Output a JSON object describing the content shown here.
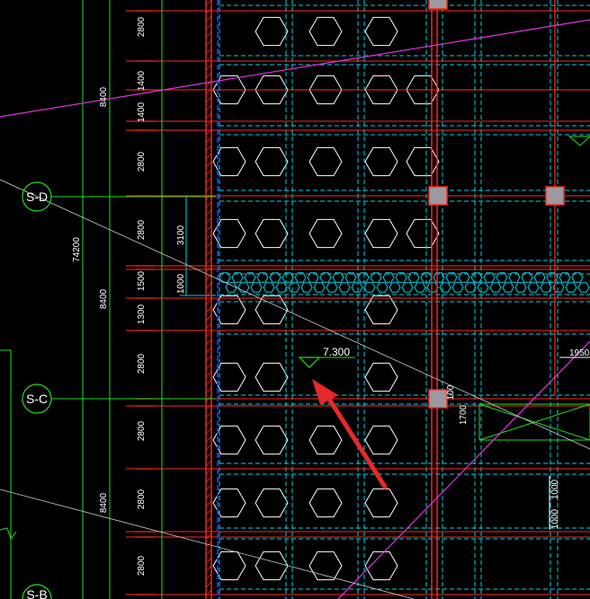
{
  "colors": {
    "background": "#000000",
    "red_lines": "#ff2a1f",
    "dark_red": "#c81414",
    "cyan": "#00d2e6",
    "green": "#22dd22",
    "white": "#ffffff",
    "magenta": "#e632e6",
    "blue_wall": "#2233ff",
    "gray_column": "#9a9aa0",
    "arrow": "#e8282a"
  },
  "grid_axes": [
    {
      "label": "S-D"
    },
    {
      "label": "S-C"
    },
    {
      "label": "S-B"
    }
  ],
  "dimensions": {
    "vertical_segments": [
      "2800",
      "1400",
      "1400",
      "2800",
      "2800",
      "1500",
      "1300",
      "2800",
      "2800",
      "2800",
      "2800",
      "2800"
    ],
    "bay_totals": [
      "8400",
      "8400",
      "8400"
    ],
    "overall": "74200",
    "extra": [
      "3100",
      "1000",
      "1950",
      "100",
      "1700",
      "1000",
      "1000"
    ]
  },
  "elevation_marker": {
    "value": "7.300"
  },
  "annotation_arrow": {
    "icon": "red-pointer-arrow"
  }
}
